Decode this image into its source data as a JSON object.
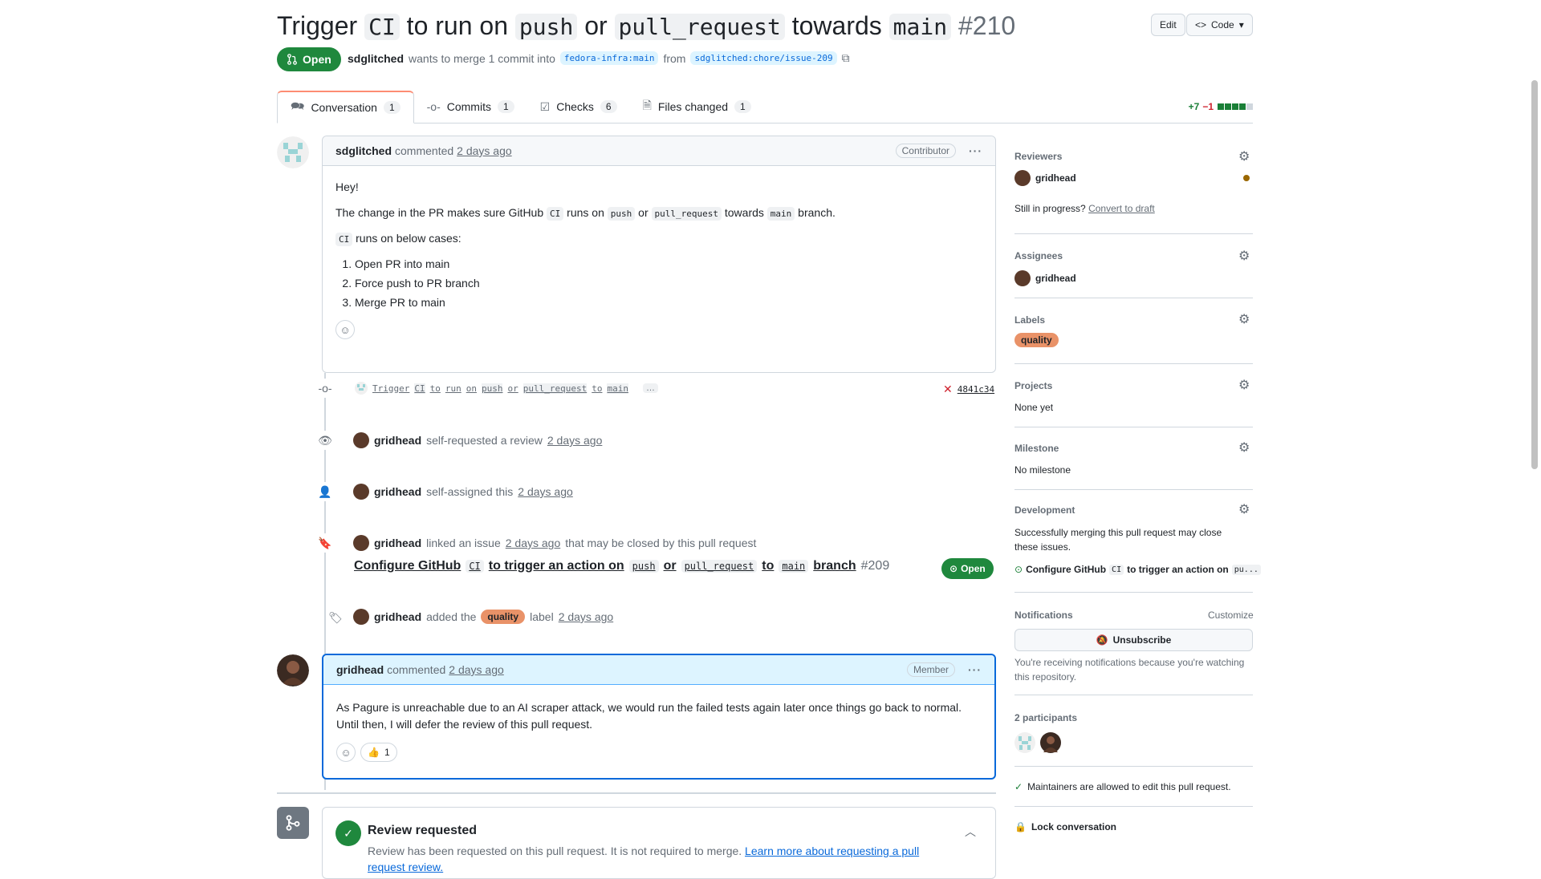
{
  "pr": {
    "title_parts": [
      "Trigger ",
      "CI",
      " to run on ",
      "push",
      " or ",
      "pull_request",
      " towards ",
      "main"
    ],
    "number": "#210",
    "state": "Open",
    "author": "sdglitched",
    "merge_text": "wants to merge 1 commit into",
    "base_branch": "fedora-infra:main",
    "from_text": "from",
    "head_branch": "sdglitched:chore/issue-209",
    "edit_label": "Edit",
    "code_label": "Code"
  },
  "tabs": [
    {
      "label": "Conversation",
      "count": "1"
    },
    {
      "label": "Commits",
      "count": "1"
    },
    {
      "label": "Checks",
      "count": "6"
    },
    {
      "label": "Files changed",
      "count": "1"
    }
  ],
  "diffstat": {
    "additions": "+7",
    "deletions": "−1"
  },
  "comment1": {
    "author": "sdglitched",
    "action": "commented",
    "time": "2 days ago",
    "role": "Contributor",
    "greeting": "Hey!",
    "line1": [
      "The change in the PR makes sure GitHub ",
      "CI",
      " runs on ",
      "push",
      " or ",
      "pull_request",
      " towards ",
      "main",
      " branch."
    ],
    "line2": [
      "CI",
      " runs on below cases:"
    ],
    "list": [
      "Open PR into main",
      "Force push to PR branch",
      "Merge PR to main"
    ]
  },
  "commit": {
    "message": [
      "Trigger",
      "CI",
      "to",
      "run",
      "on",
      "push",
      "or",
      "pull_request",
      "to",
      "main"
    ],
    "more": "…",
    "sha": "4841c34"
  },
  "events": {
    "review": {
      "user": "gridhead",
      "text": "self-requested a review",
      "time": "2 days ago"
    },
    "assign": {
      "user": "gridhead",
      "text": "self-assigned this",
      "time": "2 days ago"
    },
    "link": {
      "user": "gridhead",
      "text": "linked an issue",
      "time": "2 days ago",
      "suffix": "that may be closed by this pull request",
      "issue_parts": [
        "Configure GitHub",
        "CI",
        "to trigger an action on",
        "push",
        "or",
        "pull_request",
        "to",
        "main",
        "branch"
      ],
      "issue_number": "#209",
      "issue_state": "Open"
    },
    "label": {
      "user": "gridhead",
      "text": "added the",
      "label": "quality",
      "after": "label",
      "time": "2 days ago"
    }
  },
  "comment2": {
    "author": "gridhead",
    "action": "commented",
    "time": "2 days ago",
    "role": "Member",
    "body": "As Pagure is unreachable due to an AI scraper attack, we would run the failed tests again later once things go back to normal. Until then, I will defer the review of this pull request.",
    "reaction": "1"
  },
  "review_box": {
    "title": "Review requested",
    "text": "Review has been requested on this pull request. It is not required to merge.",
    "link": "Learn more about requesting a pull request review."
  },
  "sidebar": {
    "reviewers": {
      "title": "Reviewers",
      "user": "gridhead",
      "status_text": "Still in progress?",
      "draft_link": "Convert to draft"
    },
    "assignees": {
      "title": "Assignees",
      "user": "gridhead"
    },
    "labels": {
      "title": "Labels",
      "label": "quality"
    },
    "projects": {
      "title": "Projects",
      "value": "None yet"
    },
    "milestone": {
      "title": "Milestone",
      "value": "No milestone"
    },
    "development": {
      "title": "Development",
      "text": "Successfully merging this pull request may close these issues.",
      "issue": [
        "Configure GitHub",
        "CI",
        "to trigger an action on",
        "pu..."
      ]
    },
    "notifications": {
      "title": "Notifications",
      "customize": "Customize",
      "button": "Unsubscribe",
      "text": "You're receiving notifications because you're watching this repository."
    },
    "participants": {
      "title": "2 participants"
    },
    "maintainers": "Maintainers are allowed to edit this pull request.",
    "lock": "Lock conversation"
  },
  "colors": {
    "open_green": "#1f883d",
    "link_blue": "#0969da",
    "label_quality": "#e99268",
    "active_tab": "#fd8c73"
  }
}
